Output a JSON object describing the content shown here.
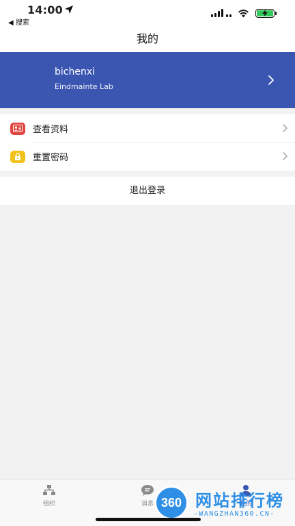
{
  "status_bar": {
    "time": "14:00",
    "back_label": "◀ 搜索"
  },
  "nav": {
    "title": "我的"
  },
  "profile": {
    "name": "bichenxi",
    "organization": "Eindmainte Lab"
  },
  "menu": {
    "items": [
      {
        "label": "查看资料",
        "icon": "contact-card-icon",
        "color": "#e0453f"
      },
      {
        "label": "重置密码",
        "icon": "lock-icon",
        "color": "#f2c21b"
      }
    ]
  },
  "logout": {
    "label": "退出登录"
  },
  "tab_bar": {
    "tabs": [
      {
        "label": "组织",
        "icon": "org-chart-icon"
      },
      {
        "label": "消息",
        "icon": "chat-bubble-icon"
      },
      {
        "label": "我的",
        "icon": "person-icon"
      }
    ]
  },
  "watermark": {
    "logo_text": "360",
    "title": "网站排行榜",
    "subtitle": "-WANGZHAN360.CN-"
  },
  "colors": {
    "accent": "#3a56b1",
    "background": "#f2f2f2"
  }
}
